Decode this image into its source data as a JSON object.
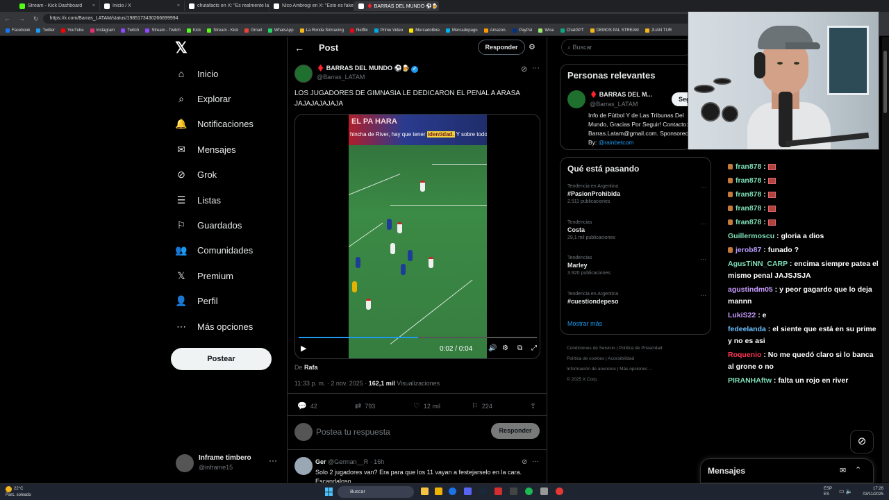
{
  "browser": {
    "tabs": [
      {
        "label": "Stream - Kick Dashboard",
        "color": "#53fc18"
      },
      {
        "label": "Inicio / X",
        "color": "#ffffff"
      },
      {
        "label": "chutafacts en X: \"Es realmente la ...",
        "color": "#ffffff"
      },
      {
        "label": "Nico Ambrogi en X: \"Esto es fake",
        "color": "#ffffff"
      },
      {
        "label": "♦️ BARRAS DEL MUNDO ⚽🍺",
        "color": "#ffffff"
      }
    ],
    "url": "https://x.com/Barras_LATAM/status/1985173430266699994",
    "bookmarks": [
      {
        "label": "Facebook",
        "color": "#1877f2"
      },
      {
        "label": "Twitter",
        "color": "#1d9bf0"
      },
      {
        "label": "YouTube",
        "color": "#ff0000"
      },
      {
        "label": "Instagram",
        "color": "#e1306c"
      },
      {
        "label": "Twitch",
        "color": "#9146ff"
      },
      {
        "label": "Stream - Twitch",
        "color": "#9146ff"
      },
      {
        "label": "Kick",
        "color": "#53fc18"
      },
      {
        "label": "Stream - Kick",
        "color": "#53fc18"
      },
      {
        "label": "Gmail",
        "color": "#ea4335"
      },
      {
        "label": "WhatsApp",
        "color": "#25d366"
      },
      {
        "label": "La Ronda Simracing",
        "color": "#f5b51b"
      },
      {
        "label": "Netflix",
        "color": "#e50914"
      },
      {
        "label": "Prime Video",
        "color": "#00a8e1"
      },
      {
        "label": "Mercadolibre",
        "color": "#ffe600"
      },
      {
        "label": "Mercadopago",
        "color": "#00b1ea"
      },
      {
        "label": "Amazon.",
        "color": "#ff9900"
      },
      {
        "label": "PayPal",
        "color": "#003087"
      },
      {
        "label": "Wise",
        "color": "#9fe870"
      },
      {
        "label": "ChatGPT",
        "color": "#10a37f"
      },
      {
        "label": "DEMOS PAL STREAM",
        "color": "#f5b51b"
      },
      {
        "label": "JUAN TUR",
        "color": "#f5b51b"
      }
    ]
  },
  "nav": {
    "items": [
      {
        "label": "Inicio",
        "icon": "home-icon"
      },
      {
        "label": "Explorar",
        "icon": "search-icon"
      },
      {
        "label": "Notificaciones",
        "icon": "bell-icon"
      },
      {
        "label": "Mensajes",
        "icon": "mail-icon"
      },
      {
        "label": "Grok",
        "icon": "grok-icon"
      },
      {
        "label": "Listas",
        "icon": "list-icon"
      },
      {
        "label": "Guardados",
        "icon": "bookmark-icon"
      },
      {
        "label": "Comunidades",
        "icon": "communities-icon"
      },
      {
        "label": "Premium",
        "icon": "x-icon"
      },
      {
        "label": "Perfil",
        "icon": "person-icon"
      },
      {
        "label": "Más opciones",
        "icon": "more-icon"
      }
    ],
    "post_button": "Postear",
    "profile": {
      "name": "Inframe timbero",
      "handle": "@inframe15"
    }
  },
  "post": {
    "header_title": "Post",
    "reply_top": "Responder",
    "author_name": "♦️ BARRAS DEL MUNDO ⚽🍺",
    "author_handle": "@Barras_LATAM",
    "text": "LOS JUGADORES DE GIMNASIA LE DEDICARON EL PENAL A ARASA JAJAJAJAJAJA",
    "video": {
      "banner_prefix": "hincha de River, hay que tener",
      "banner_highlight": "identidad.",
      "banner_suffix": "Y sobre todo, hay",
      "banner_top": "EL PA    HARA",
      "time": "0:02 / 0:04",
      "progress": 0.5
    },
    "from_prefix": "De",
    "from_name": "Rafa",
    "timestamp": "11:33 p. m. · 2 nov. 2025 · ",
    "views": "162,1 mil",
    "views_label": " Visualizaciones",
    "stats": {
      "replies": "42",
      "reposts": "793",
      "likes": "12 mil",
      "bookmarks": "224"
    },
    "reply_placeholder": "Postea tu respuesta",
    "reply_button": "Responder"
  },
  "reply": {
    "name": "Ger",
    "meta": "@German__R · 16h",
    "text": "Solo 2 jugadores van? Era para que los 11 vayan a festejarselo en la cara. Escandaloso"
  },
  "sidebar": {
    "search_placeholder": "Buscar",
    "relevant_title": "Personas relevantes",
    "relevant_name": "♦️ BARRAS DEL M...",
    "relevant_handle": "@Barras_LATAM",
    "follow_label": "Seguir",
    "bio": "Info de Fútbol Y de Las Tribunas Del Mundo, Gracias Por Seguir! Contacto: Barras.Latam@gmail.com. Sponsored By: ",
    "bio_link": "@rainbetcom",
    "trending_title": "Qué está pasando",
    "trends": [
      {
        "context": "Tendencia en Argentina",
        "name": "#PasionProhibida",
        "count": "2.511 publicaciones"
      },
      {
        "context": "Tendencias",
        "name": "Costa",
        "count": "29,1 mil publicaciones"
      },
      {
        "context": "Tendencias",
        "name": "Marley",
        "count": "3.920 publicaciones"
      },
      {
        "context": "Tendencia en Argentina",
        "name": "#cuestiondepeso",
        "count": ""
      }
    ],
    "show_more": "Mostrar más",
    "footer": [
      "Condiciones de Servicio",
      "Política de Privacidad",
      "Política de cookies",
      "Accesibilidad",
      "Información de anuncios",
      "Más opciones ...",
      "© 2025 X Corp."
    ]
  },
  "chat": {
    "messages": [
      {
        "user": "fran878",
        "text": "",
        "color": "#7ee0b8",
        "badge": true,
        "emote": true
      },
      {
        "user": "fran878",
        "text": "",
        "color": "#7ee0b8",
        "badge": true,
        "emote": true
      },
      {
        "user": "fran878",
        "text": "",
        "color": "#7ee0b8",
        "badge": true,
        "emote": true
      },
      {
        "user": "fran878",
        "text": "",
        "color": "#7ee0b8",
        "badge": true,
        "emote": true
      },
      {
        "user": "fran878",
        "text": "",
        "color": "#7ee0b8",
        "badge": true,
        "emote": true
      },
      {
        "user": "Guillermoscu",
        "text": "gloria a dios",
        "color": "#7ee0b8",
        "badge": false,
        "emote": false
      },
      {
        "user": "jerob87",
        "text": "funado ?",
        "color": "#b99cff",
        "badge": true,
        "emote": false
      },
      {
        "user": "AgusTiNN_CARP",
        "text": "encima siempre patea el mismo penal JAJSJSJA",
        "color": "#7ee0b8",
        "badge": false,
        "emote": false
      },
      {
        "user": "agustindm05",
        "text": "y peor gagardo que lo deja mannn",
        "color": "#c99cff",
        "badge": false,
        "emote": false
      },
      {
        "user": "LukiS22",
        "text": "e",
        "color": "#c99cff",
        "badge": false,
        "emote": false
      },
      {
        "user": "fedeelanda",
        "text": "el siente que está en su prime y no es asi",
        "color": "#6cc0ff",
        "badge": false,
        "emote": false
      },
      {
        "user": "Roquenio",
        "text": "No me quedó claro si lo banca al grone o no",
        "color": "#ff3355",
        "badge": false,
        "emote": false
      },
      {
        "user": "PIRANHAftw",
        "text": "falta un rojo en river",
        "color": "#7ee0b8",
        "badge": false,
        "emote": false
      }
    ]
  },
  "messages_drawer": {
    "title": "Mensajes"
  },
  "taskbar": {
    "weather_temp": "22°C",
    "weather_desc": "Parc. soleado",
    "search": "Buscar",
    "lang1": "ESP",
    "lang2": "ES",
    "time": "17:26",
    "date": "03/11/2025"
  }
}
